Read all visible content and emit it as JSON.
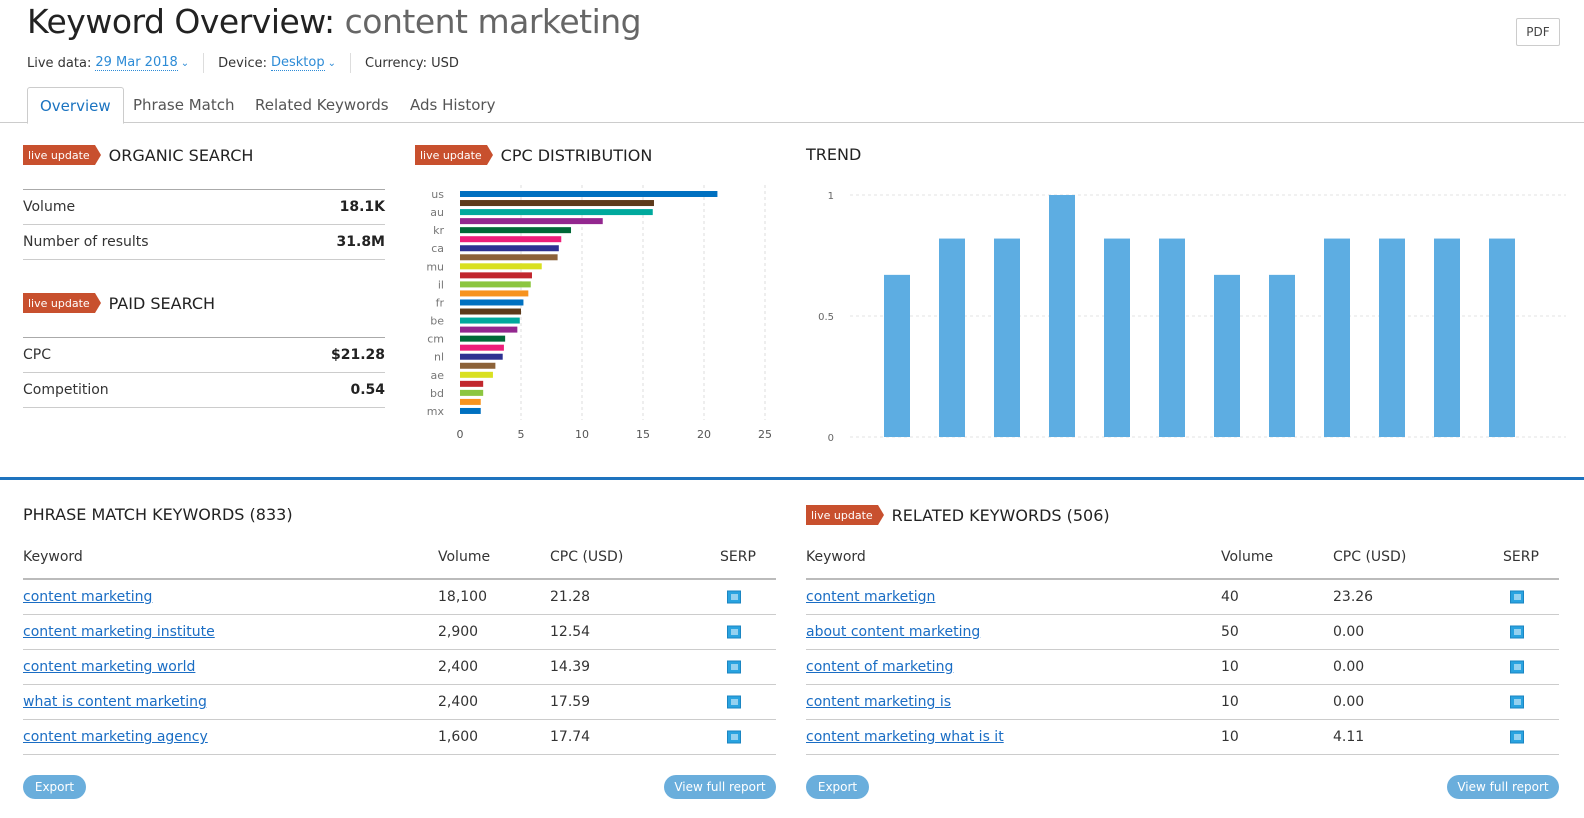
{
  "header": {
    "title_prefix": "Keyword Overview:",
    "keyword": "content marketing",
    "pdf_label": "PDF",
    "live_data_label": "Live data:",
    "live_data_value": "29 Mar 2018",
    "device_label": "Device:",
    "device_value": "Desktop",
    "currency": "Currency: USD"
  },
  "tabs": [
    {
      "label": "Overview",
      "active": true
    },
    {
      "label": "Phrase Match"
    },
    {
      "label": "Related Keywords"
    },
    {
      "label": "Ads History"
    }
  ],
  "badge": "live update",
  "organic": {
    "title": "ORGANIC SEARCH",
    "rows": [
      {
        "label": "Volume",
        "value": "18.1K"
      },
      {
        "label": "Number of results",
        "value": "31.8M"
      }
    ]
  },
  "paid": {
    "title": "PAID SEARCH",
    "rows": [
      {
        "label": "CPC",
        "value": "$21.28"
      },
      {
        "label": "Competition",
        "value": "0.54"
      }
    ]
  },
  "cpc_title": "CPC DISTRIBUTION",
  "trend_title": "TREND",
  "chart_data": [
    {
      "type": "bar",
      "orientation": "horizontal",
      "title": "CPC DISTRIBUTION",
      "categories": [
        "us",
        "",
        "au",
        "",
        "kr",
        "",
        "ca",
        "",
        "mu",
        "",
        "il",
        "",
        "fr",
        "",
        "be",
        "",
        "cm",
        "",
        "nl",
        "",
        "ae",
        "",
        "bd",
        "",
        "mx"
      ],
      "values": [
        21.1,
        15.9,
        15.8,
        11.7,
        9.1,
        8.3,
        8.1,
        8.0,
        6.7,
        5.9,
        5.8,
        5.6,
        5.2,
        5.0,
        4.9,
        4.7,
        3.7,
        3.6,
        3.5,
        2.9,
        2.7,
        1.9,
        1.9,
        1.7,
        1.7
      ],
      "colors": [
        "#0070c0",
        "#5c3a1a",
        "#00a99d",
        "#93278f",
        "#006837",
        "#ed1e79",
        "#2e3192",
        "#8c6239",
        "#d9e021",
        "#c1272d",
        "#8cc63f",
        "#f7931e"
      ],
      "xlim": [
        0,
        25
      ],
      "xticks": [
        0,
        5,
        10,
        15,
        20,
        25
      ],
      "grid": true
    },
    {
      "type": "bar",
      "title": "TREND",
      "values": [
        0.67,
        0.82,
        0.82,
        1,
        0.82,
        0.82,
        0.67,
        0.67,
        0.82,
        0.82,
        0.82,
        0.82
      ],
      "ylim": [
        0,
        1
      ],
      "yticks": [
        0,
        0.5,
        1
      ],
      "color": "#5dade2",
      "grid": true
    }
  ],
  "phrase": {
    "title": "PHRASE MATCH KEYWORDS (833)",
    "headers": [
      "Keyword",
      "Volume",
      "CPC (USD)",
      "SERP"
    ],
    "rows": [
      [
        "content marketing",
        "18,100",
        "21.28"
      ],
      [
        "content marketing institute",
        "2,900",
        "12.54"
      ],
      [
        "content marketing world",
        "2,400",
        "14.39"
      ],
      [
        "what is content marketing",
        "2,400",
        "17.59"
      ],
      [
        "content marketing agency",
        "1,600",
        "17.74"
      ]
    ],
    "export": "Export",
    "full": "View full report"
  },
  "related": {
    "title": "RELATED KEYWORDS (506)",
    "headers": [
      "Keyword",
      "Volume",
      "CPC (USD)",
      "SERP"
    ],
    "rows": [
      [
        "content marketign",
        "40",
        "23.26"
      ],
      [
        "about content marketing",
        "50",
        "0.00"
      ],
      [
        "content of marketing",
        "10",
        "0.00"
      ],
      [
        "content marketing is",
        "10",
        "0.00"
      ],
      [
        "content marketing what is it",
        "10",
        "4.11"
      ]
    ],
    "export": "Export",
    "full": "View full report"
  }
}
